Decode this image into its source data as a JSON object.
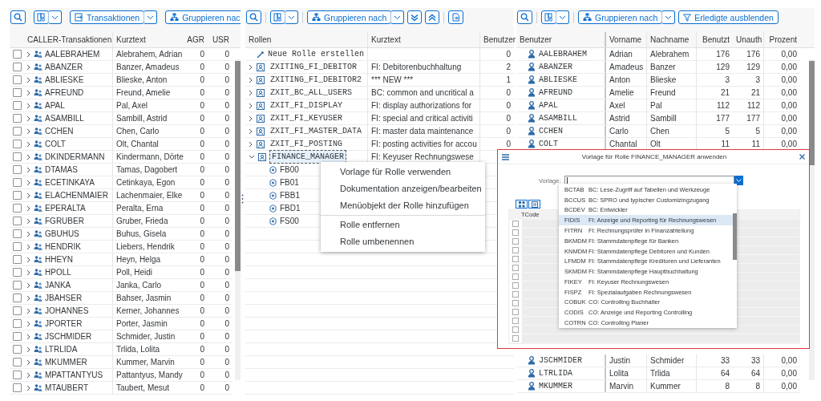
{
  "transactions": {
    "toolbar": {
      "transactions_button": "Transaktionen",
      "group_button": "Gruppieren nac"
    },
    "columns": [
      "CALLER-Transaktionen",
      "Kurztext",
      "AGR",
      "USR"
    ],
    "rows": [
      {
        "code": "AALEBRAHEM",
        "name": "Alebrahem, Adrian",
        "agr": "0",
        "usr": "0",
        "checked": false
      },
      {
        "code": "ABANZER",
        "name": "Banzer, Amadeus",
        "agr": "0",
        "usr": "0",
        "checked": false
      },
      {
        "code": "ABLIESKE",
        "name": "Blieske, Anton",
        "agr": "0",
        "usr": "0",
        "checked": false
      },
      {
        "code": "AFREUND",
        "name": "Freund, Amelie",
        "agr": "0",
        "usr": "0",
        "checked": false
      },
      {
        "code": "APAL",
        "name": "Pal, Axel",
        "agr": "0",
        "usr": "0",
        "checked": false
      },
      {
        "code": "ASAMBILL",
        "name": "Sambill, Astrid",
        "agr": "0",
        "usr": "0",
        "checked": false
      },
      {
        "code": "CCHEN",
        "name": "Chen, Carlo",
        "agr": "0",
        "usr": "0",
        "checked": false
      },
      {
        "code": "COLT",
        "name": "Olt, Chantal",
        "agr": "0",
        "usr": "0",
        "checked": false
      },
      {
        "code": "DKINDERMANN",
        "name": "Kindermann, Dörte",
        "agr": "0",
        "usr": "0",
        "checked": false
      },
      {
        "code": "DTAMAS",
        "name": "Tamas, Dagobert",
        "agr": "0",
        "usr": "0",
        "checked": false
      },
      {
        "code": "ECETINKAYA",
        "name": "Cetinkaya, Egon",
        "agr": "0",
        "usr": "0",
        "checked": false
      },
      {
        "code": "ELACHENMAIER",
        "name": "Lachenmaier, Elke",
        "agr": "0",
        "usr": "0",
        "checked": false
      },
      {
        "code": "EPERALTA",
        "name": "Peralta, Erna",
        "agr": "0",
        "usr": "0",
        "checked": false
      },
      {
        "code": "FGRUBER",
        "name": "Gruber, Frieda",
        "agr": "0",
        "usr": "0",
        "checked": false
      },
      {
        "code": "GBUHUS",
        "name": "Buhus, Gisela",
        "agr": "0",
        "usr": "0",
        "checked": false
      },
      {
        "code": "HENDRIK",
        "name": "Liebers, Hendrik",
        "agr": "0",
        "usr": "0",
        "checked": false
      },
      {
        "code": "HHEYN",
        "name": "Heyn, Helga",
        "agr": "0",
        "usr": "0",
        "checked": false
      },
      {
        "code": "HPOLL",
        "name": "Poll, Heidi",
        "agr": "0",
        "usr": "0",
        "checked": false
      },
      {
        "code": "JANKA",
        "name": "Janka, Carlo",
        "agr": "0",
        "usr": "0",
        "checked": false
      },
      {
        "code": "JBAHSER",
        "name": "Bahser, Jasmin",
        "agr": "0",
        "usr": "0",
        "checked": false
      },
      {
        "code": "JOHANNES",
        "name": "Kerner, Johannes",
        "agr": "0",
        "usr": "0",
        "checked": false
      },
      {
        "code": "JPORTER",
        "name": "Porter, Jasmin",
        "agr": "0",
        "usr": "0",
        "checked": false
      },
      {
        "code": "JSCHMIDER",
        "name": "Schmider, Justin",
        "agr": "0",
        "usr": "0",
        "checked": false
      },
      {
        "code": "LTRLIDA",
        "name": "Trlida, Lolita",
        "agr": "0",
        "usr": "0",
        "checked": false
      },
      {
        "code": "MKUMMER",
        "name": "Kummer, Marvin",
        "agr": "0",
        "usr": "0",
        "checked": false
      },
      {
        "code": "MPATTANTYUS",
        "name": "Pattantyus, Mandy",
        "agr": "0",
        "usr": "0",
        "checked": false
      },
      {
        "code": "MTAUBERT",
        "name": "Taubert, Mesut",
        "agr": "0",
        "usr": "0",
        "checked": false
      }
    ]
  },
  "roles": {
    "toolbar": {
      "group_button": "Gruppieren nach"
    },
    "columns": [
      "Rollen",
      "Kurztext",
      "Benutzer"
    ],
    "rows": [
      {
        "kind": "action",
        "name": "Neue Rolle erstellen",
        "users": "0"
      },
      {
        "kind": "role",
        "name": "ZXITING_FI_DEBITOR",
        "text": "FI: Debitorenbuchhaltung",
        "users": "2",
        "expanded": false,
        "selected": false
      },
      {
        "kind": "role",
        "name": "ZXITING_FI_DEBITOR2",
        "text": "*** NEW ***",
        "users": "1",
        "expanded": false,
        "selected": false
      },
      {
        "kind": "role",
        "name": "ZXIT_BC_ALL_USERS",
        "text": "BC: common and uncritical a",
        "users": "0",
        "expanded": false,
        "selected": false
      },
      {
        "kind": "role",
        "name": "ZXIT_FI_DISPLAY",
        "text": "FI: display authorizations for",
        "users": "0",
        "expanded": false,
        "selected": false
      },
      {
        "kind": "role",
        "name": "ZXIT_FI_KEYUSER",
        "text": "FI: special and critical activiti",
        "users": "0",
        "expanded": false,
        "selected": false
      },
      {
        "kind": "role",
        "name": "ZXIT_FI_MASTER_DATA",
        "text": "FI: master data maintenance",
        "users": "0",
        "expanded": false,
        "selected": false
      },
      {
        "kind": "role",
        "name": "ZXIT_FI_POSTING",
        "text": "FI: posting activities for accou",
        "users": "0",
        "expanded": false,
        "selected": false
      },
      {
        "kind": "role",
        "name": "FINANCE_MANAGER",
        "text": "FI: Keyuser Rechnungswese",
        "expanded": true,
        "selected": true,
        "children": [
          {
            "name": "FB00"
          },
          {
            "name": "FB01"
          },
          {
            "name": "FBB1"
          },
          {
            "name": "FBD1"
          },
          {
            "name": "FS00"
          }
        ]
      }
    ]
  },
  "context_menu": {
    "groups": [
      [
        "Vorlage für Rolle verwenden",
        "Dokumentation anzeigen/bearbeiten",
        "Menüobjekt der Rolle hinzufügen"
      ],
      [
        "Rolle entfernen",
        "Rolle umbenennen"
      ]
    ]
  },
  "users": {
    "toolbar": {
      "group_button": "Gruppieren nach",
      "filter_button": "Erledigte ausblenden"
    },
    "columns": [
      "Benutzer",
      "Vorname",
      "Nachname",
      "Benutzt",
      "Unauth",
      "Prozent"
    ],
    "rows": [
      {
        "user": "AALEBRAHEM",
        "first": "Adrian",
        "last": "Alebrahem",
        "used": "176",
        "unauth": "176",
        "percent": "0,00"
      },
      {
        "user": "ABANZER",
        "first": "Amadeus",
        "last": "Banzer",
        "used": "129",
        "unauth": "129",
        "percent": "0,00"
      },
      {
        "user": "ABLIESKE",
        "first": "Anton",
        "last": "Blieske",
        "used": "3",
        "unauth": "3",
        "percent": "0,00"
      },
      {
        "user": "AFREUND",
        "first": "Amelie",
        "last": "Freund",
        "used": "21",
        "unauth": "21",
        "percent": "0,00"
      },
      {
        "user": "APAL",
        "first": "Axel",
        "last": "Pal",
        "used": "112",
        "unauth": "112",
        "percent": "0,00"
      },
      {
        "user": "ASAMBILL",
        "first": "Astrid",
        "last": "Sambill",
        "used": "177",
        "unauth": "177",
        "percent": "0,00"
      },
      {
        "user": "CCHEN",
        "first": "Carlo",
        "last": "Chen",
        "used": "5",
        "unauth": "5",
        "percent": "0,00"
      },
      {
        "user": "COLT",
        "first": "Chantal",
        "last": "Olt",
        "used": "11",
        "unauth": "11",
        "percent": "0,00"
      },
      {
        "user": "JSCHMIDER",
        "first": "Justin",
        "last": "Schmider",
        "used": "33",
        "unauth": "33",
        "percent": "0,00"
      },
      {
        "user": "LTRLIDA",
        "first": "Lolita",
        "last": "Trlida",
        "used": "64",
        "unauth": "64",
        "percent": "0,00"
      },
      {
        "user": "MKUMMER",
        "first": "Marvin",
        "last": "Kummer",
        "used": "8",
        "unauth": "8",
        "percent": "0,00"
      }
    ]
  },
  "dialog": {
    "title": "Vorlage für Rolle FINANCE_MANAGER anwenden",
    "field_label": "Vorlage:",
    "table_column": "TCode",
    "table_rows": [
      {
        "checked": false
      },
      {
        "checked": false
      },
      {
        "checked": false
      },
      {
        "checked": false
      },
      {
        "checked": false
      },
      {
        "checked": false
      },
      {
        "checked": false
      },
      {
        "checked": false
      },
      {
        "checked": false
      },
      {
        "checked": false
      },
      {
        "checked": false
      },
      {
        "checked": false
      },
      {
        "checked": false
      },
      {
        "checked": false
      }
    ],
    "options": [
      {
        "code": "BCTAB",
        "text": "BC: Lese-Zugriff auf Tabellen und Werkzeuge",
        "selected": false
      },
      {
        "code": "BCCUS",
        "text": "BC: SPRO und typischer Customizingzugang",
        "selected": false
      },
      {
        "code": "BCDEV",
        "text": "BC: Entwickler",
        "selected": false
      },
      {
        "code": "FIDIS",
        "text": "FI: Anzeige und Reporting für Rechnungswesen",
        "selected": true
      },
      {
        "code": "FITRN",
        "text": "FI: Rechnungsprüfer in Finanzabteilung",
        "selected": false
      },
      {
        "code": "BKMDM",
        "text": "FI: Stammdatenpflege für Banken",
        "selected": false
      },
      {
        "code": "KNMDM",
        "text": "FI: Stammdatenpflege Debitoren und Kunden",
        "selected": false
      },
      {
        "code": "LFMDM",
        "text": "FI: Stammdatenpflege Kreditoren und Lieferanten",
        "selected": false
      },
      {
        "code": "SKMDM",
        "text": "FI: Stammdatenpflege Hauptbuchhaltung",
        "selected": false
      },
      {
        "code": "FIKEY",
        "text": "FI: Keyuser Rechnungswesen",
        "selected": false
      },
      {
        "code": "FISPZ",
        "text": "FI: Spezialaufgaben Rechnungswesen",
        "selected": false
      },
      {
        "code": "COBUK",
        "text": "CO: Controlling Buchhalter",
        "selected": false
      },
      {
        "code": "CODIS",
        "text": "CO: Anzeige und Reporting Controlling",
        "selected": false
      },
      {
        "code": "COTRN",
        "text": "CO: Controlling Planer",
        "selected": false
      }
    ]
  }
}
